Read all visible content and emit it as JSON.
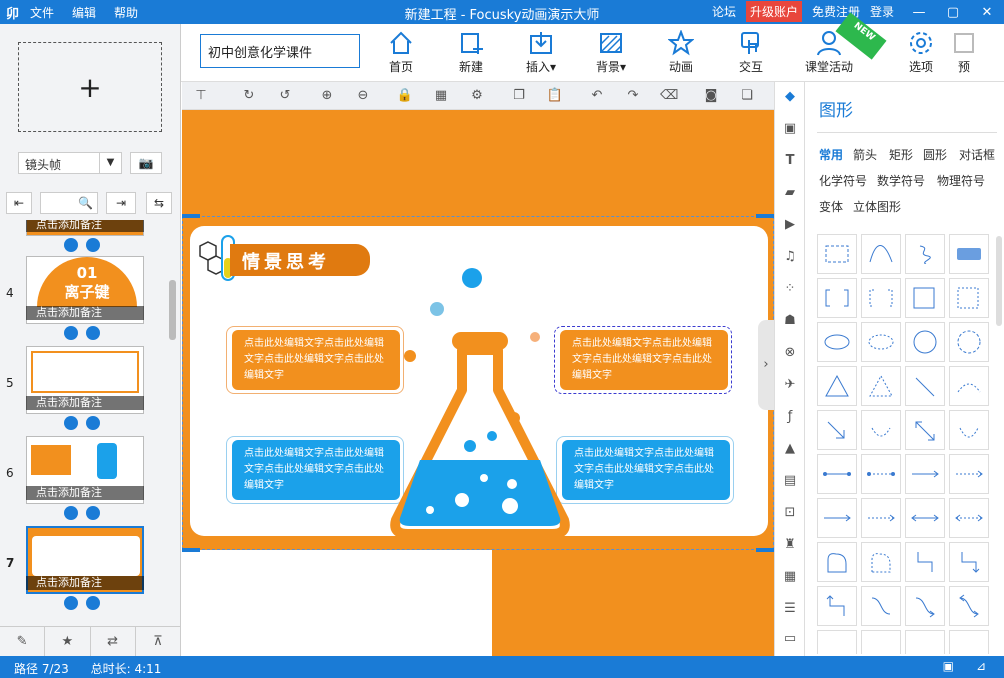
{
  "titlebar": {
    "logo": "卯",
    "menu": [
      "文件",
      "编辑",
      "帮助"
    ],
    "title": "新建工程 - Focusky动画演示大师",
    "forum": "论坛",
    "upgrade": "升级账户",
    "register": "免费注册",
    "login": "登录"
  },
  "ribbon": {
    "project_name": "初中创意化学课件",
    "buttons": [
      {
        "label": "首页",
        "icon": "home-icon"
      },
      {
        "label": "新建",
        "icon": "new-slide-icon"
      },
      {
        "label": "插入▾",
        "icon": "insert-icon"
      },
      {
        "label": "背景▾",
        "icon": "background-icon"
      },
      {
        "label": "动画",
        "icon": "animation-icon"
      },
      {
        "label": "交互",
        "icon": "interaction-icon"
      },
      {
        "label": "课堂活动",
        "icon": "classroom-icon"
      },
      {
        "label": "选项",
        "icon": "gear-icon"
      },
      {
        "label": "预",
        "icon": "preview-icon"
      }
    ],
    "new_tag": "NEW"
  },
  "left": {
    "frame_type": "镜头帧",
    "slides": [
      {
        "num": "",
        "title": "",
        "note": "点击添加备注"
      },
      {
        "num": "4",
        "title": "01\n离子键",
        "note": "点击添加备注"
      },
      {
        "num": "5",
        "title": "",
        "note": "点击添加备注"
      },
      {
        "num": "6",
        "title": "",
        "note": "点击添加备注"
      },
      {
        "num": "7",
        "title": "",
        "note": "点击添加备注"
      }
    ],
    "slide4_big": "01",
    "slide4_sub": "离子键"
  },
  "status": {
    "path": "路径 7/23",
    "duration": "总时长: 4:11"
  },
  "canvas": {
    "heading": "情景思考",
    "bubble_text": "点击此处编辑文字点击此处编辑文字点击此处编辑文字点击此处编辑文字",
    "bubbles": [
      {
        "color": "orange",
        "text": "点击此处编辑文字点击此处编辑文字点击此处编辑文字点击此处编辑文字"
      },
      {
        "color": "orange",
        "text": "点击此处编辑文字点击此处编辑文字点击此处编辑文字点击此处编辑文字"
      },
      {
        "color": "blue",
        "text": "点击此处编辑文字点击此处编辑文字点击此处编辑文字点击此处编辑文字"
      },
      {
        "color": "blue",
        "text": "点击此处编辑文字点击此处编辑文字点击此处编辑文字点击此处编辑文字"
      }
    ],
    "colors": {
      "orange": "#f2901e",
      "blue": "#1ba1ea"
    }
  },
  "right": {
    "title": "图形",
    "categories_row1": [
      "常用",
      "箭头",
      "矩形",
      "圆形",
      "对话框"
    ],
    "categories_row2": [
      "化学符号",
      "数学符号",
      "物理符号"
    ],
    "categories_row3": [
      "变体",
      "立体图形"
    ]
  }
}
